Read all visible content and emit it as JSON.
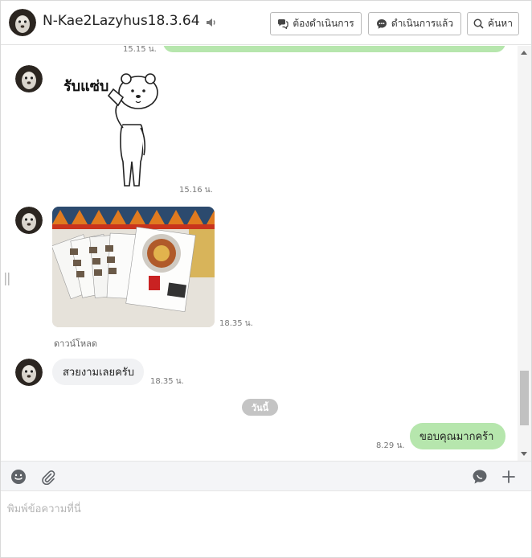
{
  "header": {
    "title": "N-Kae2Lazyhus18.3.64",
    "buttons": {
      "todo": "ต้องดำเนินการ",
      "done": "ดำเนินการแล้ว",
      "search": "ค้นหา"
    }
  },
  "messages": {
    "top_partial_time": "15.15 น.",
    "sticker": {
      "text": "รับแซ่บ",
      "time": "15.16 น."
    },
    "photo": {
      "time": "18.35 น.",
      "download_label": "ดาวน์โหลด"
    },
    "text_in": {
      "text": "สวยงามเลยครับ",
      "time": "18.35 น."
    },
    "date_divider": "วันนี้",
    "text_out": {
      "text": "ขอบคุณมากคร้า",
      "time": "8.29 น."
    }
  },
  "composer": {
    "placeholder": "พิมพ์ข้อความที่นี่"
  },
  "colors": {
    "outgoing_bubble": "#b6e6ad",
    "incoming_bubble": "#f1f2f4",
    "date_pill": "#c4c4c4",
    "toolbar_bg": "#f4f5f7"
  }
}
